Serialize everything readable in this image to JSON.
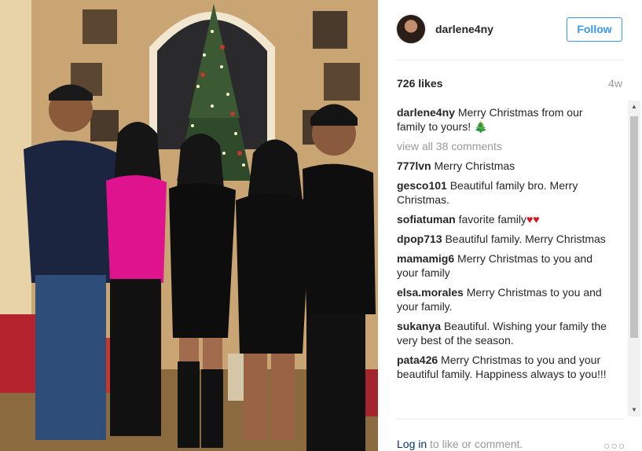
{
  "post": {
    "username": "darlene4ny",
    "follow_label": "Follow",
    "likes": "726 likes",
    "age": "4w"
  },
  "caption": {
    "user": "darlene4ny",
    "text": "Merry Christmas from our family to yours!",
    "emoji": "🎄"
  },
  "view_all": "view all 38 comments",
  "comments": [
    {
      "user": "777lvn",
      "text": "Merry Christmas"
    },
    {
      "user": "gesco101",
      "text": "Beautiful family bro. Merry Christmas."
    },
    {
      "user": "sofiatuman",
      "text": "favorite family",
      "emoji": "♥♥"
    },
    {
      "user": "dpop713",
      "text": "Beautiful family. Merry Christmas"
    },
    {
      "user": "mamamig6",
      "text": "Merry Christmas to you and your family"
    },
    {
      "user": "elsa.morales",
      "text": "Merry Christmas to you and your family."
    },
    {
      "user": "sukanya",
      "text": "Beautiful. Wishing your family the very best of the season."
    },
    {
      "user": "pata426",
      "text": "Merry Christmas to you and your beautiful family. Happiness always to you!!!"
    }
  ],
  "footer": {
    "login_label": "Log in",
    "login_suffix": "to like or comment.",
    "more_icon": "more-icon"
  },
  "colors": {
    "accent": "#3897f0",
    "link": "#003569",
    "muted": "#999999"
  }
}
